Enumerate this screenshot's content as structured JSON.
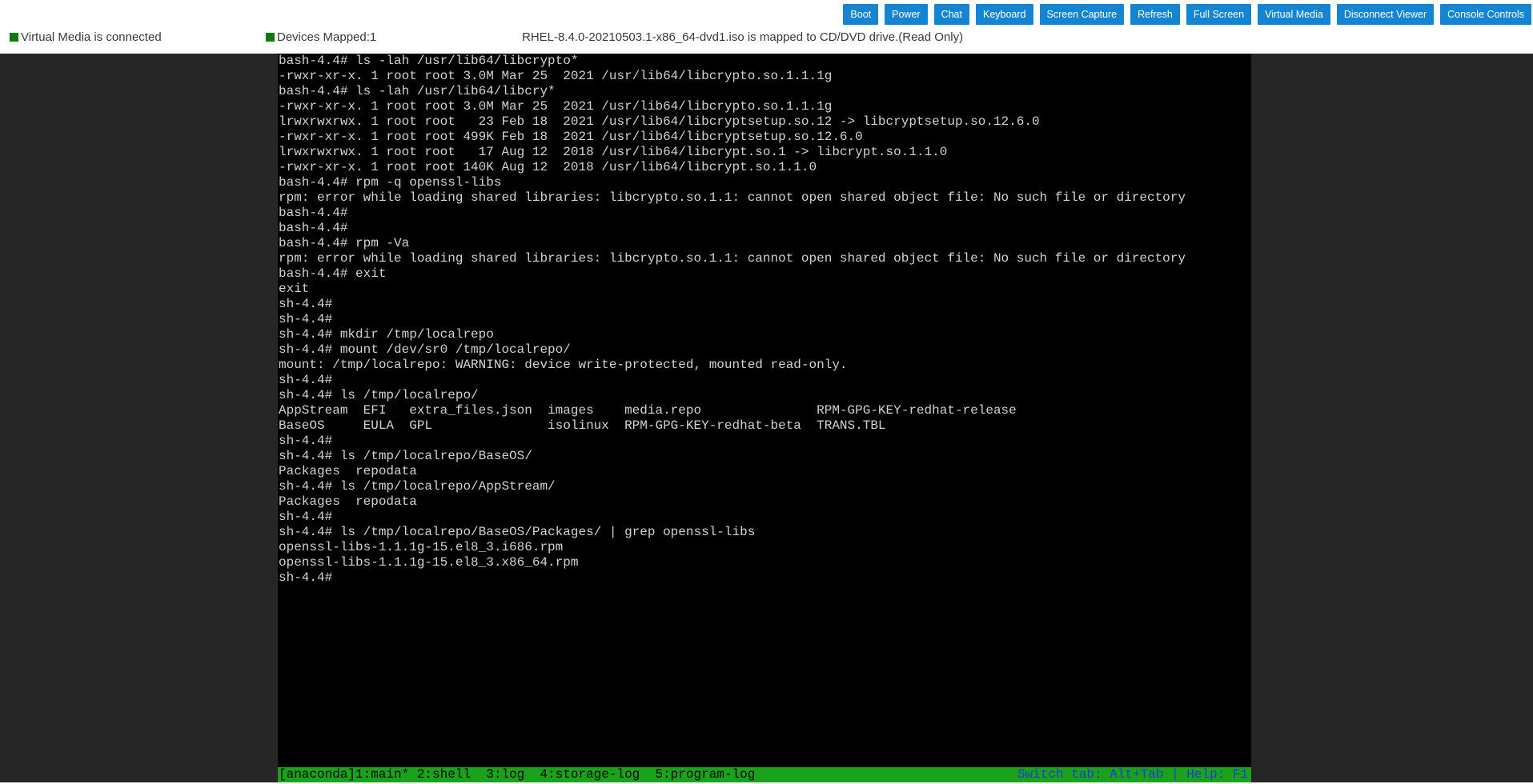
{
  "toolbar": {
    "buttons": [
      {
        "label": "Boot"
      },
      {
        "label": "Power"
      },
      {
        "label": "Chat"
      },
      {
        "label": "Keyboard"
      },
      {
        "label": "Screen Capture"
      },
      {
        "label": "Refresh"
      },
      {
        "label": "Full Screen"
      },
      {
        "label": "Virtual Media"
      },
      {
        "label": "Disconnect Viewer"
      },
      {
        "label": "Console Controls"
      }
    ]
  },
  "status": {
    "virtual_media": "Virtual Media is connected",
    "devices_mapped": "Devices Mapped:1",
    "iso_mapping": "RHEL-8.4.0-20210503.1-x86_64-dvd1.iso is mapped to CD/DVD drive.(Read Only)",
    "indicator_color": "#107a10"
  },
  "terminal": {
    "lines": [
      "bash-4.4# ls -lah /usr/lib64/libcrypto*",
      "-rwxr-xr-x. 1 root root 3.0M Mar 25  2021 /usr/lib64/libcrypto.so.1.1.1g",
      "bash-4.4# ls -lah /usr/lib64/libcry*",
      "-rwxr-xr-x. 1 root root 3.0M Mar 25  2021 /usr/lib64/libcrypto.so.1.1.1g",
      "lrwxrwxrwx. 1 root root   23 Feb 18  2021 /usr/lib64/libcryptsetup.so.12 -> libcryptsetup.so.12.6.0",
      "-rwxr-xr-x. 1 root root 499K Feb 18  2021 /usr/lib64/libcryptsetup.so.12.6.0",
      "lrwxrwxrwx. 1 root root   17 Aug 12  2018 /usr/lib64/libcrypt.so.1 -> libcrypt.so.1.1.0",
      "-rwxr-xr-x. 1 root root 140K Aug 12  2018 /usr/lib64/libcrypt.so.1.1.0",
      "bash-4.4# rpm -q openssl-libs",
      "rpm: error while loading shared libraries: libcrypto.so.1.1: cannot open shared object file: No such file or directory",
      "bash-4.4#",
      "bash-4.4#",
      "bash-4.4# rpm -Va",
      "rpm: error while loading shared libraries: libcrypto.so.1.1: cannot open shared object file: No such file or directory",
      "bash-4.4# exit",
      "exit",
      "sh-4.4#",
      "sh-4.4#",
      "sh-4.4# mkdir /tmp/localrepo",
      "sh-4.4# mount /dev/sr0 /tmp/localrepo/",
      "mount: /tmp/localrepo: WARNING: device write-protected, mounted read-only.",
      "sh-4.4#",
      "sh-4.4# ls /tmp/localrepo/",
      "AppStream  EFI   extra_files.json  images    media.repo               RPM-GPG-KEY-redhat-release",
      "BaseOS     EULA  GPL               isolinux  RPM-GPG-KEY-redhat-beta  TRANS.TBL",
      "sh-4.4#",
      "sh-4.4# ls /tmp/localrepo/BaseOS/",
      "Packages  repodata",
      "sh-4.4# ls /tmp/localrepo/AppStream/",
      "Packages  repodata",
      "sh-4.4#",
      "sh-4.4# ls /tmp/localrepo/BaseOS/Packages/ | grep openssl-libs",
      "openssl-libs-1.1.1g-15.el8_3.i686.rpm",
      "openssl-libs-1.1.1g-15.el8_3.x86_64.rpm",
      "sh-4.4#"
    ]
  },
  "tmux": {
    "left": "[anaconda]1:main* 2:shell  3:log  4:storage-log  5:program-log",
    "right": "Switch tab: Alt+Tab | Help: F1"
  },
  "colors": {
    "toolbar_button": "#1585d2",
    "viewer_background": "#262626",
    "terminal_background": "#000000",
    "terminal_text": "#d2d2d2",
    "tmux_bar": "#1aa31a",
    "tmux_right_text": "#1f3ad8"
  }
}
